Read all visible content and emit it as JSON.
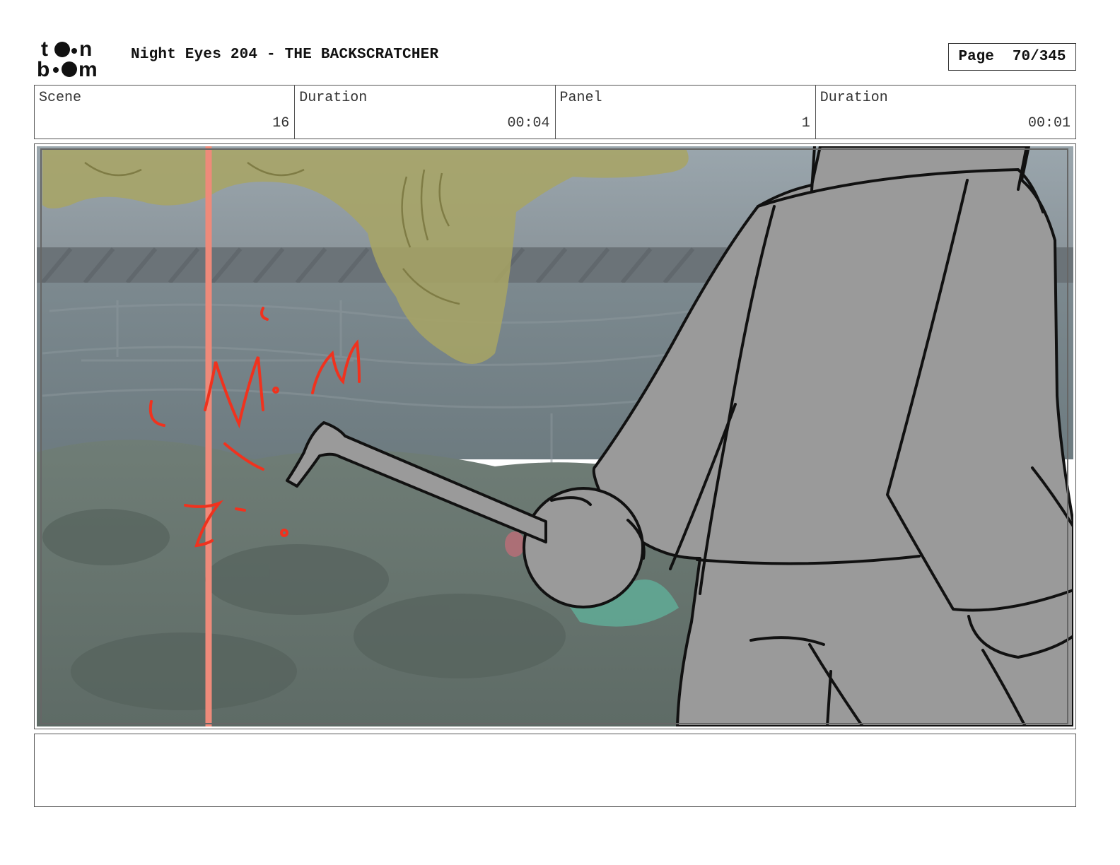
{
  "header": {
    "logo_text": "toon boom",
    "title": "Night Eyes 204 - THE BACKSCRATCHER",
    "page_label": "Page",
    "page_value": "70/345"
  },
  "info": {
    "scene_label": "Scene",
    "scene_value": "16",
    "scene_duration_label": "Duration",
    "scene_duration_value": "00:04",
    "panel_label": "Panel",
    "panel_value": "1",
    "panel_duration_label": "Duration",
    "panel_duration_value": "00:01"
  },
  "panel": {
    "sfx_text": "Mim",
    "colors": {
      "sketch_red": "#f0321e",
      "guide_line": "#ee8a7a",
      "character_fill": "#9a9a9a",
      "ink": "#111111"
    }
  },
  "notes": {
    "text": ""
  }
}
